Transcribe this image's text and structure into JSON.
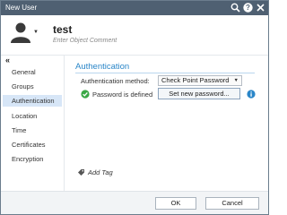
{
  "window": {
    "title": "New User"
  },
  "titlebar": {
    "icons": [
      "search-icon",
      "help-icon",
      "close-icon"
    ]
  },
  "object": {
    "name": "test",
    "comment_placeholder": "Enter Object Comment"
  },
  "sidebar": {
    "collapse_glyph": "«",
    "items": [
      {
        "label": "General",
        "active": false
      },
      {
        "label": "Groups",
        "active": false
      },
      {
        "label": "Authentication",
        "active": true
      },
      {
        "label": "Location",
        "active": false
      },
      {
        "label": "Time",
        "active": false
      },
      {
        "label": "Certificates",
        "active": false
      },
      {
        "label": "Encryption",
        "active": false
      }
    ]
  },
  "authentication": {
    "section_title": "Authentication",
    "method_label": "Authentication method:",
    "method_value": "Check Point Password",
    "password_status": "Password is defined",
    "set_password_label": "Set new password..."
  },
  "tags": {
    "add_tag_label": "Add Tag"
  },
  "footer": {
    "ok_label": "OK",
    "cancel_label": "Cancel"
  },
  "colors": {
    "titlebar": "#4f6072",
    "accent": "#2a86c8",
    "active_nav": "#d7e6f7",
    "success": "#3aa845"
  }
}
